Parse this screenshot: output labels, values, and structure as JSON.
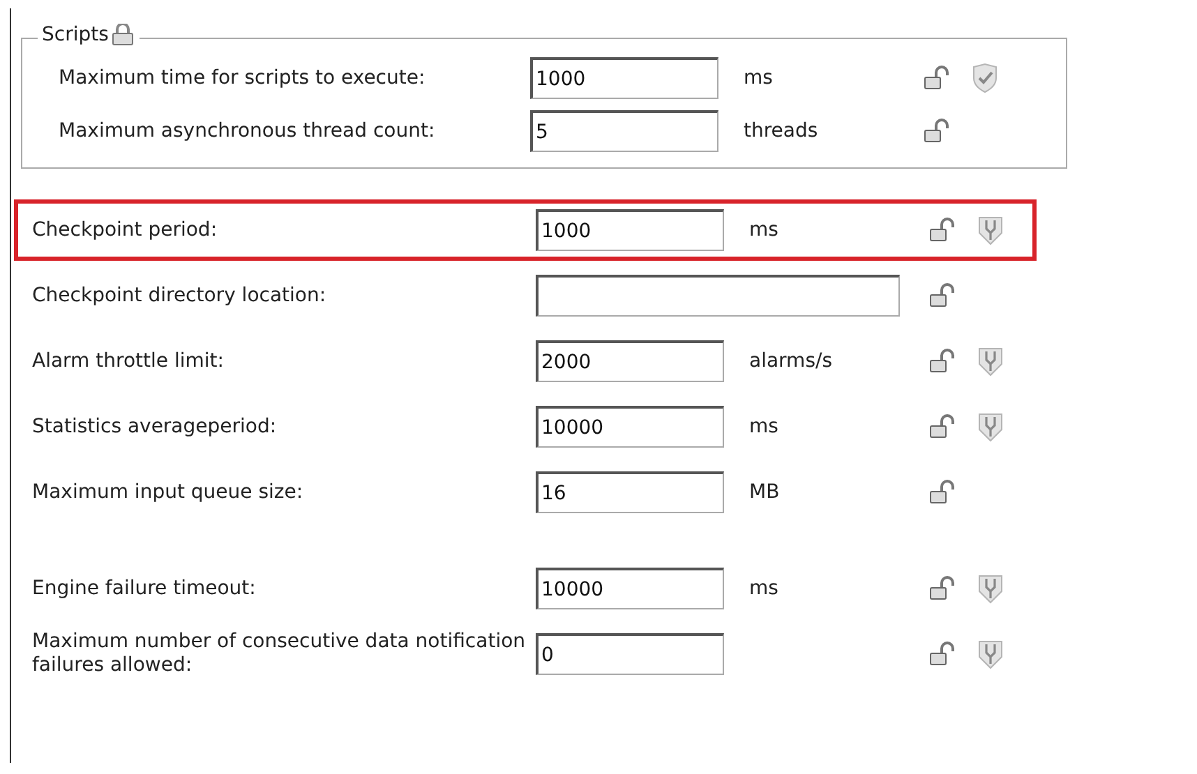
{
  "scripts_group": {
    "title": "Scripts",
    "rows": [
      {
        "label": "Maximum time for scripts to execute:",
        "value": "1000",
        "unit": "ms",
        "kind": "check"
      },
      {
        "label": "Maximum asynchronous thread count:",
        "value": "5",
        "unit": "threads",
        "kind": "plain"
      }
    ]
  },
  "sections": [
    {
      "rows": [
        {
          "label": "Checkpoint period:",
          "value": "1000",
          "unit": "ms",
          "kind": "fork",
          "highlighted": true,
          "wide": false
        },
        {
          "label": "Checkpoint directory location:",
          "value": "",
          "kind": "plain",
          "highlighted": false,
          "wide": true
        },
        {
          "label": "Alarm throttle limit:",
          "value": "2000",
          "unit": "alarms/s",
          "kind": "fork",
          "highlighted": false,
          "wide": false
        },
        {
          "label": "Statistics averageperiod:",
          "value": "10000",
          "unit": "ms",
          "kind": "fork",
          "highlighted": false,
          "wide": false
        },
        {
          "label": "Maximum input queue size:",
          "value": "16",
          "unit": "MB",
          "kind": "plain",
          "highlighted": false,
          "wide": false
        }
      ]
    },
    {
      "rows": [
        {
          "label": "Engine failure timeout:",
          "value": "10000",
          "unit": "ms",
          "kind": "fork",
          "highlighted": false,
          "wide": false
        },
        {
          "label": "Maximum number of consecutive data notification failures allowed:",
          "value": "0",
          "kind": "fork",
          "highlighted": false,
          "wide": false
        }
      ]
    }
  ]
}
